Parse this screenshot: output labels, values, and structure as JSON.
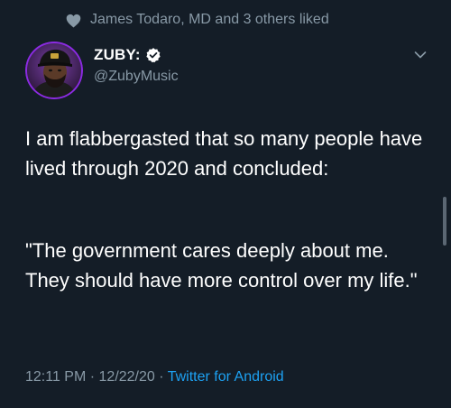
{
  "social_context": {
    "text": "James Todaro, MD and 3 others liked",
    "icon": "heart-icon"
  },
  "author": {
    "display_name": "ZUBY:",
    "handle": "@ZubyMusic",
    "verified": true
  },
  "tweet": {
    "paragraph_1": "I am flabbergasted that so many people have lived through 2020 and concluded:",
    "paragraph_2": "\"The government cares deeply about me. They should have more control over my life.\""
  },
  "meta": {
    "time": "12:11 PM",
    "separator": " · ",
    "date": "12/22/20",
    "source": "Twitter for Android"
  },
  "colors": {
    "background": "#141d27",
    "secondary_text": "#8899a6",
    "link": "#1da1f2",
    "verified_badge": "#ffffff"
  }
}
